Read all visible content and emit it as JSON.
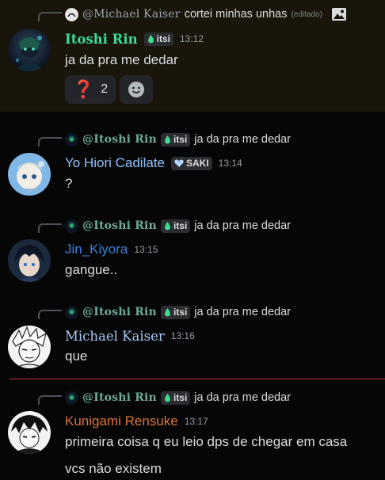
{
  "messages": [
    {
      "reply": {
        "user": "@Michael Kaiser",
        "text": "cortei minhas unhas",
        "edited": "(editado)"
      },
      "author": "Itoshi Rin",
      "tag": "itsi",
      "time": "13:12",
      "content": "ja da pra me dedar",
      "reactions": [
        {
          "emoji": "❓",
          "count": "2"
        }
      ],
      "icons": {
        "avatar": "avatar-green-glow",
        "attachment": "image-icon",
        "add_reaction": "add-reaction-icon"
      }
    },
    {
      "reply": {
        "user": "@Itoshi Rin",
        "tag": "itsi",
        "text": "ja da pra me dedar"
      },
      "author": "Yo Hiori Cadilate",
      "tag": "SAKI",
      "time": "13:14",
      "content": "?"
    },
    {
      "reply": {
        "user": "@Itoshi Rin",
        "tag": "itsi",
        "text": "ja da pra me dedar"
      },
      "author": "Jin_Kiyora",
      "time": "13:15",
      "content": "gangue.."
    },
    {
      "reply": {
        "user": "@Itoshi Rin",
        "tag": "itsi",
        "text": "ja da pra me dedar"
      },
      "author": "Michael Kaiser",
      "time": "13:16",
      "content": "que"
    },
    {
      "reply": {
        "user": "@Itoshi Rin",
        "tag": "itsi",
        "text": "ja da pra me dedar"
      },
      "author": "Kunigami Rensuke",
      "time": "13:17",
      "content": "primeira coisa q eu leio dps de chegar em casa",
      "content2": "vcs não existem"
    }
  ],
  "colors": {
    "rin": "#3ddc97",
    "hiori": "#8fc2ff",
    "jin": "#3b7fd9",
    "kaiser": "#a7c9f2",
    "kunigami": "#d9733c",
    "reply_name": "#6fa89b"
  }
}
